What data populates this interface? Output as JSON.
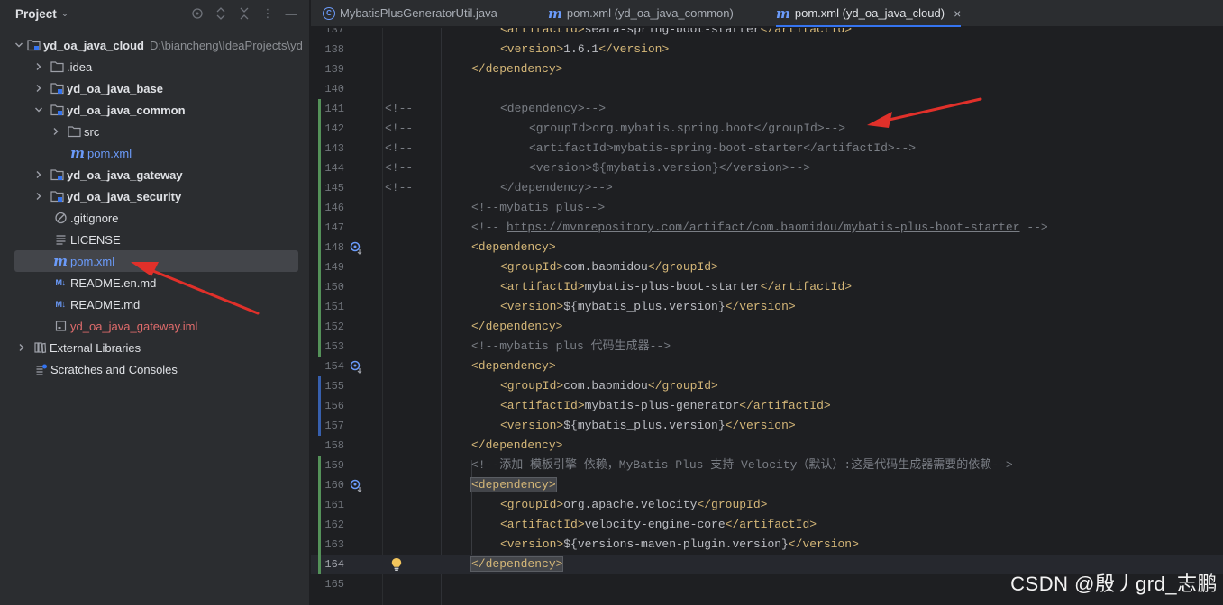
{
  "project_panel": {
    "title": "Project",
    "tree": [
      {
        "label": "yd_oa_java_cloud",
        "path": "D:\\biancheng\\IdeaProjects\\yd",
        "icon": "module-folder-icon",
        "expanded": true,
        "level": 0
      },
      {
        "label": ".idea",
        "icon": "folder-icon",
        "expanded": false,
        "level": 1
      },
      {
        "label": "yd_oa_java_base",
        "icon": "module-folder-icon",
        "expanded": false,
        "level": 1
      },
      {
        "label": "yd_oa_java_common",
        "icon": "module-folder-icon",
        "expanded": true,
        "level": 1
      },
      {
        "label": "src",
        "icon": "folder-icon",
        "expanded": false,
        "level": 2
      },
      {
        "label": "pom.xml",
        "icon": "maven-icon",
        "level": 2
      },
      {
        "label": "yd_oa_java_gateway",
        "icon": "module-folder-icon",
        "expanded": false,
        "level": 1
      },
      {
        "label": "yd_oa_java_security",
        "icon": "module-folder-icon",
        "expanded": false,
        "level": 1
      },
      {
        "label": ".gitignore",
        "icon": "ignore-icon",
        "level": 1
      },
      {
        "label": "LICENSE",
        "icon": "text-file-icon",
        "level": 1
      },
      {
        "label": "pom.xml",
        "icon": "maven-icon",
        "level": 1,
        "selected": true
      },
      {
        "label": "README.en.md",
        "icon": "markdown-icon",
        "level": 1
      },
      {
        "label": "README.md",
        "icon": "markdown-icon",
        "level": 1
      },
      {
        "label": "yd_oa_java_gateway.iml",
        "icon": "iml-file-icon",
        "level": 1
      },
      {
        "label": "External Libraries",
        "icon": "library-icon",
        "expanded": false,
        "level": 0
      },
      {
        "label": "Scratches and Consoles",
        "icon": "scratches-icon",
        "level": 0
      }
    ]
  },
  "tabs": [
    {
      "label": "MybatisPlusGeneratorUtil.java",
      "icon": "java-class-icon",
      "active": false
    },
    {
      "label": "pom.xml (yd_oa_java_common)",
      "icon": "maven-icon",
      "active": false
    },
    {
      "label": "pom.xml (yd_oa_java_cloud)",
      "icon": "maven-icon",
      "active": true,
      "close": "×"
    }
  ],
  "editor": {
    "current_line": 164,
    "lines": [
      {
        "n": "137",
        "text": "<artifactId>seata-spring-boot-starter</artifactId>"
      },
      {
        "n": "138",
        "text": "<version>1.6.1</version>"
      },
      {
        "n": "139",
        "text": "</dependency>"
      },
      {
        "n": "140",
        "text": ""
      },
      {
        "n": "141",
        "text": "<!--",
        "rest": "<dependency>-->"
      },
      {
        "n": "142",
        "text": "<!--",
        "rest": "<groupId>org.mybatis.spring.boot</groupId>-->"
      },
      {
        "n": "143",
        "text": "<!--",
        "rest": "<artifactId>mybatis-spring-boot-starter</artifactId>-->"
      },
      {
        "n": "144",
        "text": "<!--",
        "rest": "<version>${mybatis.version}</version>-->"
      },
      {
        "n": "145",
        "text": "<!--",
        "rest": "</dependency>-->"
      },
      {
        "n": "146",
        "text": "<!--mybatis plus-->"
      },
      {
        "n": "147",
        "text": "<!-- ",
        "link": "https://mvnrepository.com/artifact/com.baomidou/mybatis-plus-boot-starter",
        "rest": " -->"
      },
      {
        "n": "148",
        "text": "<dependency>"
      },
      {
        "n": "149",
        "text": "<groupId>com.baomidou</groupId>"
      },
      {
        "n": "150",
        "text": "<artifactId>mybatis-plus-boot-starter</artifactId>"
      },
      {
        "n": "151",
        "text": "<version>${mybatis_plus.version}</version>"
      },
      {
        "n": "152",
        "text": "</dependency>"
      },
      {
        "n": "153",
        "text": "<!--mybatis plus 代码生成器-->"
      },
      {
        "n": "154",
        "text": "<dependency>"
      },
      {
        "n": "155",
        "text": "<groupId>com.baomidou</groupId>"
      },
      {
        "n": "156",
        "text": "<artifactId>mybatis-plus-generator</artifactId>"
      },
      {
        "n": "157",
        "text": "<version>${mybatis_plus.version}</version>"
      },
      {
        "n": "158",
        "text": "</dependency>"
      },
      {
        "n": "159",
        "text": "<!--添加 模板引擎 依赖，MyBatis-Plus 支持 Velocity（默认）:这是代码生成器需要的依赖-->"
      },
      {
        "n": "160",
        "text": "<dependency>"
      },
      {
        "n": "161",
        "text": "<groupId>org.apache.velocity</groupId>"
      },
      {
        "n": "162",
        "text": "<artifactId>velocity-engine-core</artifactId>"
      },
      {
        "n": "163",
        "text": "<version>${versions-maven-plugin.version}</version>"
      },
      {
        "n": "164",
        "text": "</dependency>"
      },
      {
        "n": "165",
        "text": ""
      }
    ]
  },
  "watermark": "CSDN @殷丿grd_志鹏",
  "colors": {
    "accent": "#3574f0",
    "annotation_arrow": "#e0302a",
    "tag": "#d5b778",
    "comment": "#7a7e85"
  }
}
